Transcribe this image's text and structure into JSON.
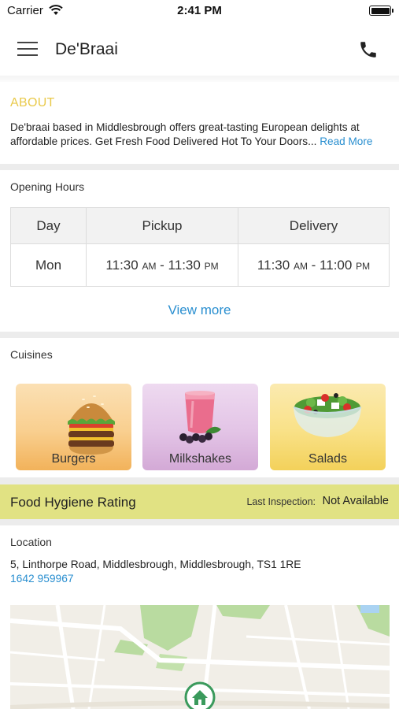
{
  "status_bar": {
    "carrier": "Carrier",
    "time": "2:41 PM",
    "icons": [
      "wifi-icon",
      "battery-icon"
    ]
  },
  "nav": {
    "title": "De'Braai",
    "icons": [
      "menu-icon",
      "phone-icon"
    ]
  },
  "about": {
    "title": "ABOUT",
    "text": "De'braai based in Middlesbrough offers great-tasting European delights at affordable prices. Get Fresh Food Delivered Hot To Your Doors",
    "ellipsis": "...",
    "read_more": "Read More"
  },
  "opening_hours": {
    "title": "Opening Hours",
    "headers": [
      "Day",
      "Pickup",
      "Delivery"
    ],
    "rows": [
      {
        "day": "Mon",
        "pickup": {
          "from": "11:30",
          "from_suffix": "AM",
          "sep": " - ",
          "to": "11:30",
          "to_suffix": "PM"
        },
        "delivery": {
          "from": "11:30",
          "from_suffix": "AM",
          "sep": " - ",
          "to": "11:00",
          "to_suffix": "PM"
        }
      }
    ],
    "view_more": "View more"
  },
  "cuisines": {
    "title": "Cuisines",
    "items": [
      {
        "label": "Burgers",
        "icon": "burger-icon"
      },
      {
        "label": "Milkshakes",
        "icon": "milkshake-icon"
      },
      {
        "label": "Salads",
        "icon": "salad-icon"
      }
    ]
  },
  "hygiene": {
    "title": "Food Hygiene Rating",
    "inspection_label": "Last Inspection:",
    "inspection_value": "Not Available",
    "bar_color": "#e1e283"
  },
  "location": {
    "title": "Location",
    "address": "5, Linthorpe Road, Middlesbrough, Middlesbrough, TS1 1RE",
    "phone": "1642 959967",
    "map_marker_icon": "home-pin-icon"
  },
  "colors": {
    "accent_link": "#2a8fd0",
    "about_title": "#e9c94a"
  }
}
